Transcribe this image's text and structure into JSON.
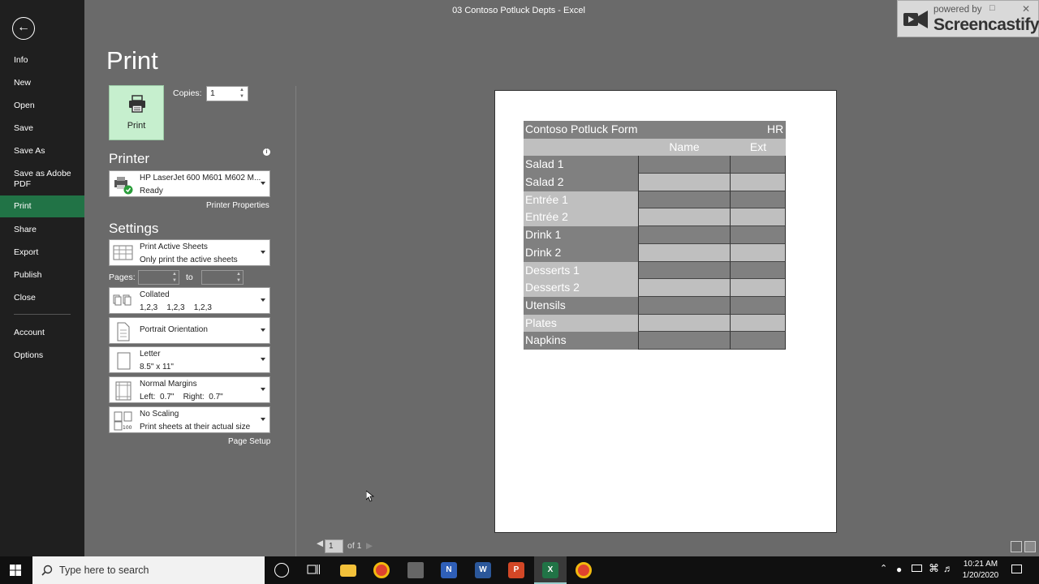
{
  "window": {
    "title": "03 Contoso Potluck Depts - Excel"
  },
  "watermark": {
    "powered_by": "powered by",
    "brand": "Screencastify"
  },
  "nav": {
    "items": [
      {
        "label": "Info"
      },
      {
        "label": "New"
      },
      {
        "label": "Open"
      },
      {
        "label": "Save"
      },
      {
        "label": "Save As"
      },
      {
        "label": "Save as Adobe PDF"
      },
      {
        "label": "Print"
      },
      {
        "label": "Share"
      },
      {
        "label": "Export"
      },
      {
        "label": "Publish"
      },
      {
        "label": "Close"
      },
      {
        "label": "Account"
      },
      {
        "label": "Options"
      }
    ],
    "active": "Print"
  },
  "print": {
    "page_title": "Print",
    "button_label": "Print",
    "copies_label": "Copies:",
    "copies_value": "1"
  },
  "printer": {
    "heading": "Printer",
    "name": "HP LaserJet 600 M601 M602 M...",
    "status": "Ready",
    "properties_link": "Printer Properties"
  },
  "settings": {
    "heading": "Settings",
    "sheets": {
      "line1": "Print Active Sheets",
      "line2": "Only print the active sheets"
    },
    "pages_label": "Pages:",
    "to_label": "to",
    "collation": {
      "line1": "Collated",
      "line2": "1,2,3    1,2,3    1,2,3"
    },
    "orientation": {
      "line1": "Portrait Orientation"
    },
    "paper": {
      "line1": "Letter",
      "line2": "8.5\" x 11\""
    },
    "margins": {
      "line1": "Normal Margins",
      "line2": "Left:  0.7\"    Right:  0.7\""
    },
    "scaling": {
      "line1": "No Scaling",
      "line2": "Print sheets at their actual size"
    },
    "page_setup_link": "Page Setup"
  },
  "preview": {
    "form_title": "Contoso Potluck Form",
    "dept": "HR",
    "col_name": "Name",
    "col_ext": "Ext",
    "rows": [
      "Salad 1",
      "Salad 2",
      "Entrée 1",
      "Entrée 2",
      "Drink 1",
      "Drink 2",
      "Desserts 1",
      "Desserts 2",
      "Utensils",
      "Plates",
      "Napkins"
    ],
    "page_current": "1",
    "page_of": "of 1"
  },
  "taskbar": {
    "search_placeholder": "Type here to search",
    "time": "10:21 AM",
    "date": "1/20/2020"
  }
}
